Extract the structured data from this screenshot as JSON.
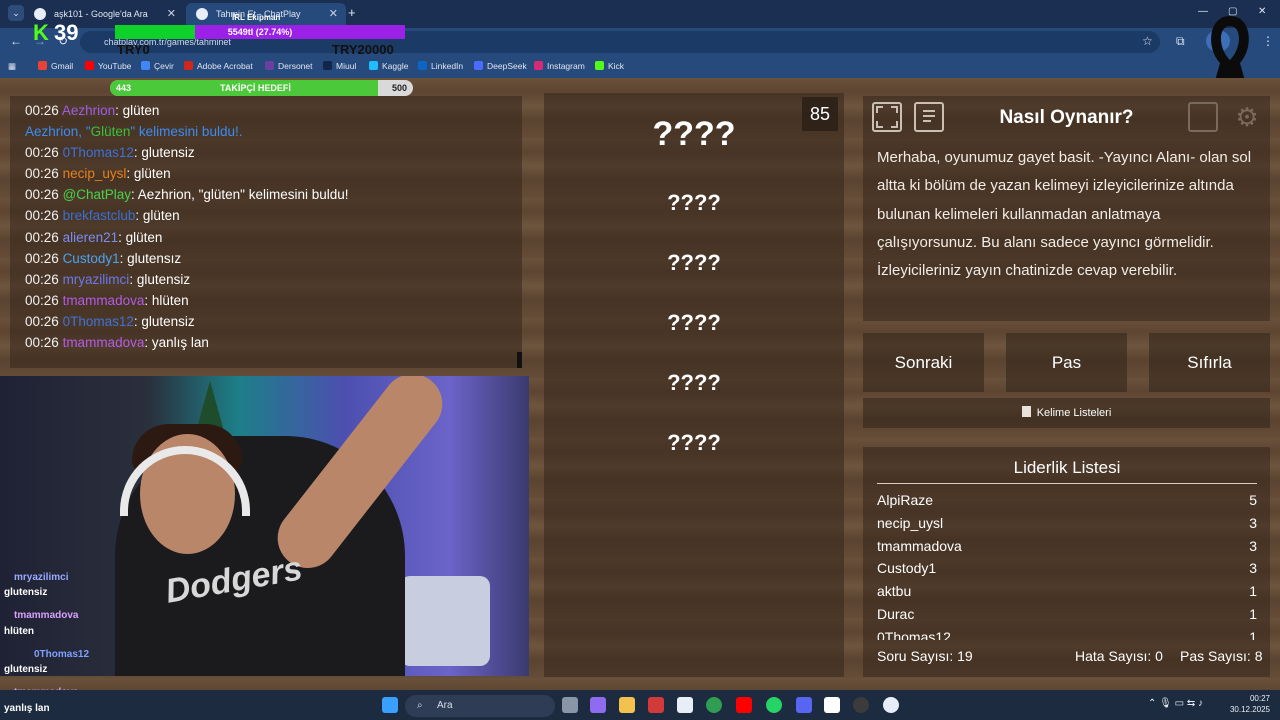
{
  "browser": {
    "tabs": [
      {
        "label": "aşk101 - Google'da Ara",
        "close": "✕"
      },
      {
        "label": "Tahmin Et - ChatPlay",
        "close": "✕"
      }
    ],
    "new_tab": "+",
    "url": "chatplay.com.tr/games/tahminet",
    "bookmarks": [
      "Gmail",
      "YouTube",
      "Çevir",
      "Adobe Acrobat",
      "Dersonet",
      "Miuul",
      "Kaggle",
      "LinkedIn",
      "DeepSeek",
      "Instagram",
      "Kick"
    ],
    "window_controls": {
      "minimize": "—",
      "maximize": "▢",
      "close": "✕"
    }
  },
  "overlay": {
    "kick_letter": "K",
    "kick_count": "39",
    "title": "İRL Ekipman",
    "progress_text": "5549tl (27.74%)",
    "progress_fraction": 0.2774,
    "left_amount": "TRY0",
    "right_amount": "TRY20000",
    "follower_goal": {
      "current": "443",
      "label": "TAKİPÇİ HEDEFİ",
      "target": "500",
      "fraction": 0.886
    }
  },
  "chat": [
    {
      "time": "00:26",
      "user": "Aezhrion",
      "color": "#a15ce6",
      "msg": ": glüten"
    },
    {
      "system": true,
      "user": "Aezhrion",
      "pre": ", \"",
      "word": "Glüten",
      "post": "\" kelimesini buldu!."
    },
    {
      "time": "00:26",
      "user": "0Thomas12",
      "color": "#3e72d8",
      "msg": ": glutensiz"
    },
    {
      "time": "00:26",
      "user": "necip_uysl",
      "color": "#e5801d",
      "msg": ": glüten"
    },
    {
      "time": "00:26",
      "user": "@ChatPlay",
      "color": "#47d34b",
      "msg": ": Aezhrion, \"glüten\" kelimesini buldu!"
    },
    {
      "time": "00:26",
      "user": "brekfastclub",
      "color": "#3b6fd0",
      "msg": ": glüten"
    },
    {
      "time": "00:26",
      "user": "alieren21",
      "color": "#7b8ef0",
      "msg": ": glüten"
    },
    {
      "time": "00:26",
      "user": "Custody1",
      "color": "#4aa2f2",
      "msg": ": glutensız"
    },
    {
      "time": "00:26",
      "user": "mryazilimci",
      "color": "#6b7ae8",
      "msg": ": glutensiz"
    },
    {
      "time": "00:26",
      "user": "tmammadova",
      "color": "#b45ce6",
      "msg": ": hlüten"
    },
    {
      "time": "00:26",
      "user": "0Thomas12",
      "color": "#3e72d8",
      "msg": ": glutensiz"
    },
    {
      "time": "00:26",
      "user": "tmammadova",
      "color": "#b45ce6",
      "msg": ": yanlış lan"
    }
  ],
  "game": {
    "timer": "85",
    "words": [
      "????",
      "????",
      "????",
      "????",
      "????",
      "????"
    ]
  },
  "how_to": {
    "title": "Nasıl Oynanır?",
    "text": "Merhaba, oyunumuz gayet basit. -Yayıncı Alanı- olan sol altta ki bölüm de yazan kelimeyi izleyicilerinize altında bulunan kelimeleri kullanmadan anlatmaya çalışıyorsunuz. Bu alanı sadece yayıncı görmelidir. İzleyicileriniz yayın chatinizde cevap verebilir."
  },
  "buttons": {
    "next": "Sonraki",
    "pass": "Pas",
    "reset": "Sıfırla",
    "word_lists": "Kelime Listeleri"
  },
  "leaderboard": {
    "title": "Liderlik Listesi",
    "rows": [
      {
        "name": "AlpiRaze",
        "score": "5"
      },
      {
        "name": "necip_uysl",
        "score": "3"
      },
      {
        "name": "tmammadova",
        "score": "3"
      },
      {
        "name": "Custody1",
        "score": "3"
      },
      {
        "name": "aktbu",
        "score": "1"
      },
      {
        "name": "Durac",
        "score": "1"
      },
      {
        "name": "0Thomas12",
        "score": "1"
      }
    ]
  },
  "stats": {
    "questions": "Soru Sayısı: 19",
    "errors": "Hata Sayısı: 0",
    "passes": "Pas Sayısı: 8"
  },
  "stream_chat": [
    {
      "user": "mryazilimci",
      "msg": "glutensiz"
    },
    {
      "user": "tmammadova",
      "msg": "hlüten"
    },
    {
      "user": "0Thomas12",
      "msg": "glutensiz"
    },
    {
      "user": "tmammadova",
      "msg": "yanlış lan"
    }
  ],
  "cam_logo": "Dodgers",
  "taskbar": {
    "search": "Ara",
    "time": "00:27",
    "date": "30.12.2025"
  },
  "colors": {
    "kick_green": "#53fc18",
    "goal_purple": "#9b21e6",
    "panel": "#34261b"
  }
}
